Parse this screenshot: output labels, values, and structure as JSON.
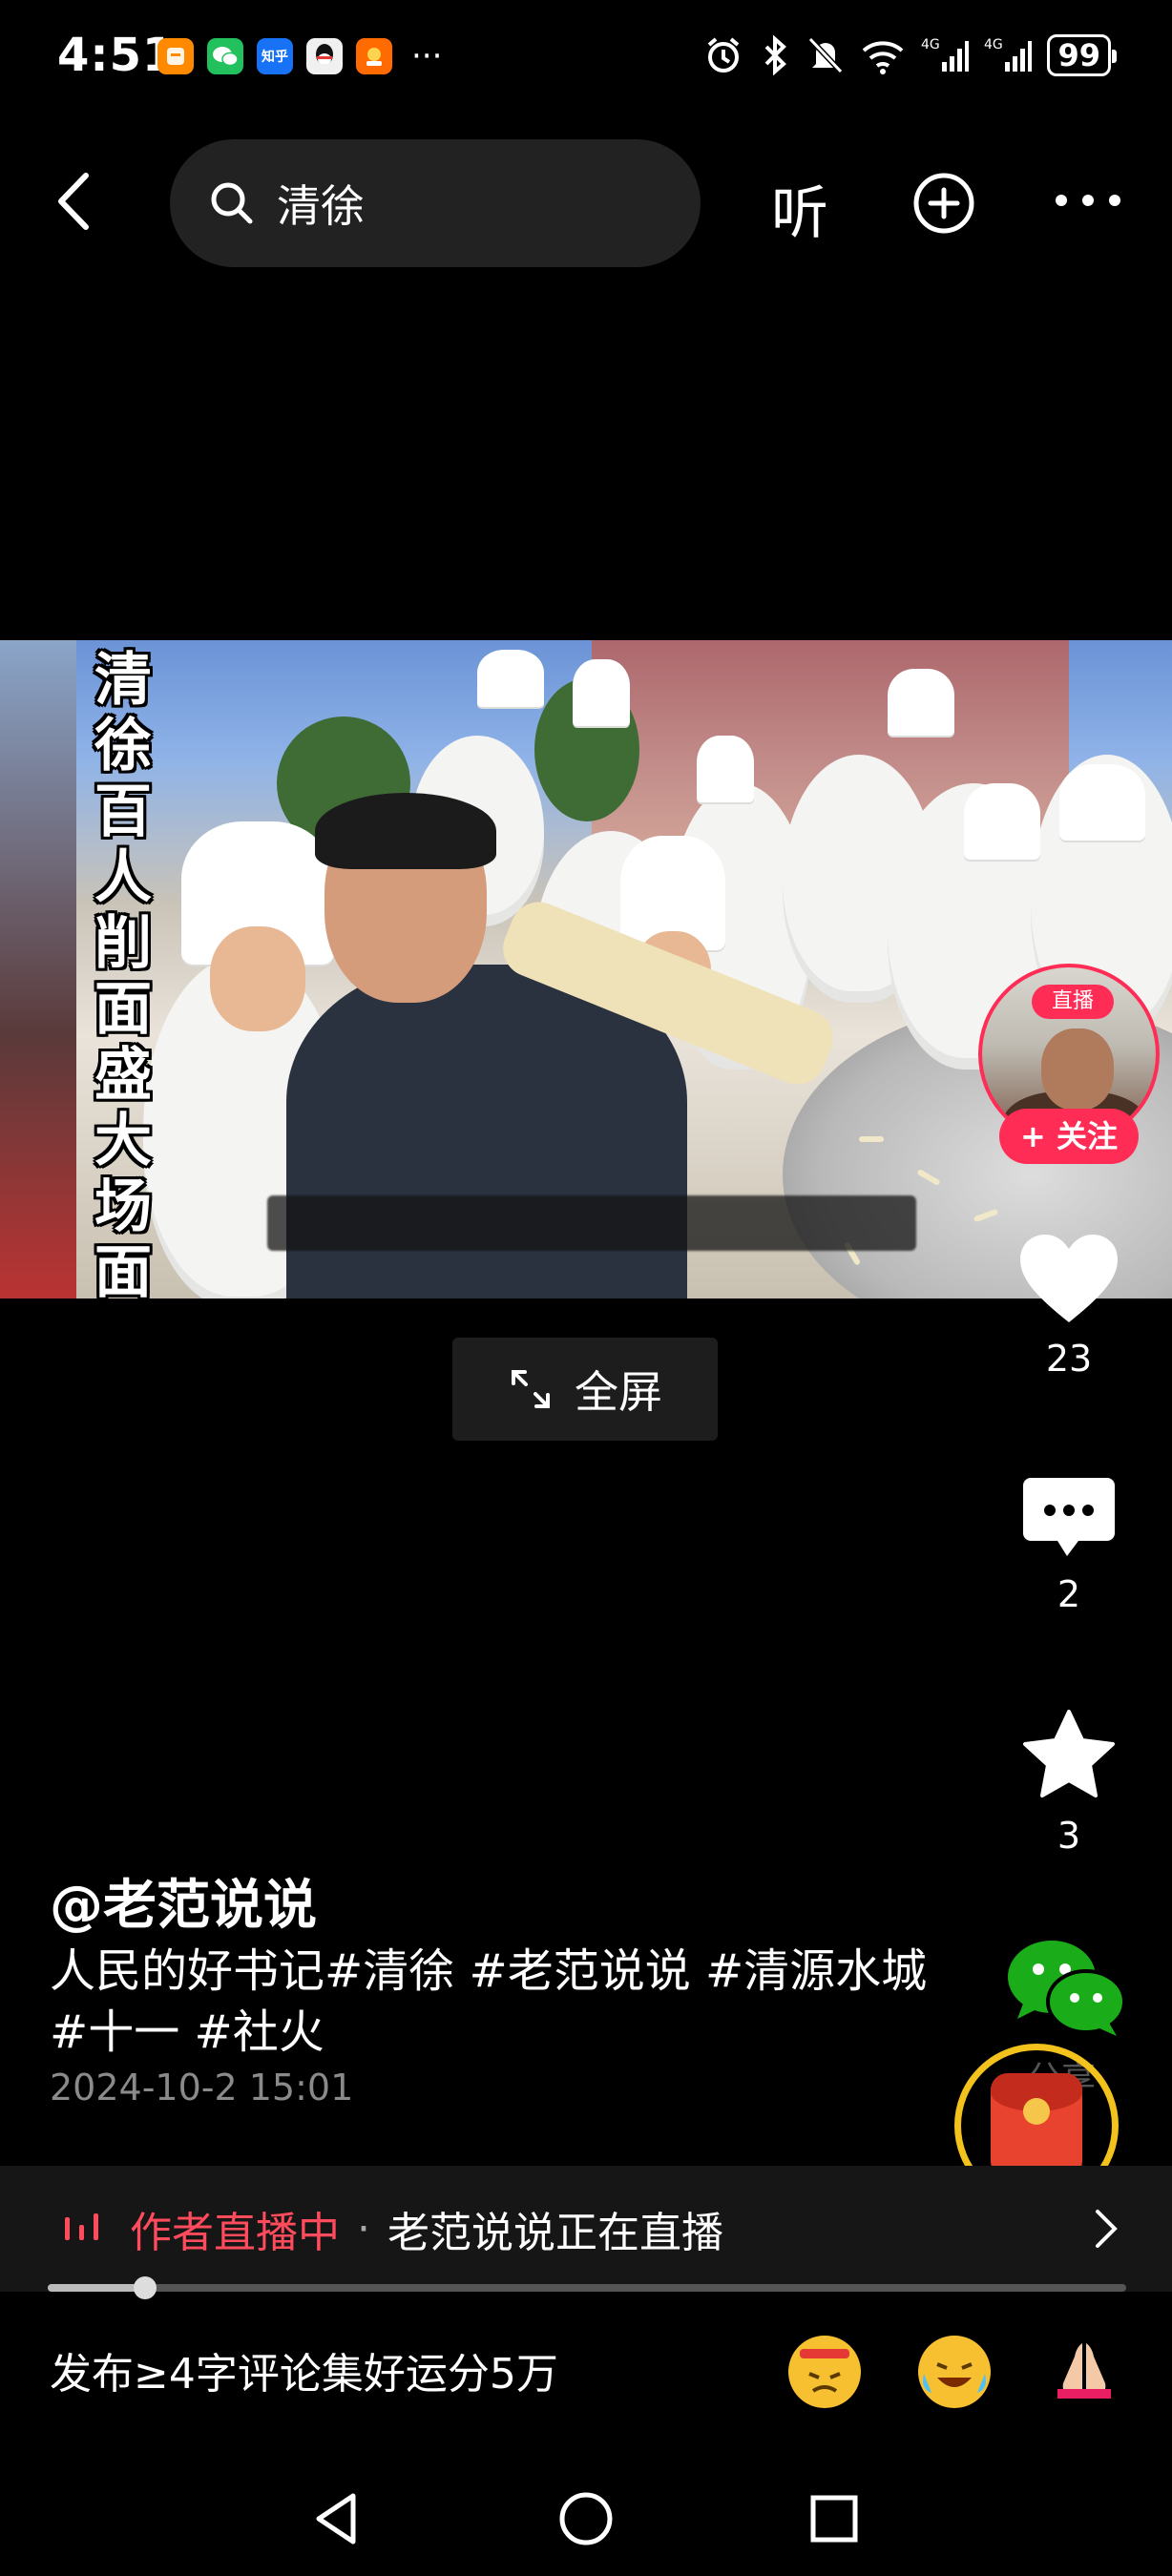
{
  "status_bar": {
    "time": "4:51",
    "apps": [
      {
        "icon": "taobao-icon",
        "color": "#ff8a00",
        "label": ""
      },
      {
        "icon": "wechat-icon",
        "color": "#22c15e",
        "label": ""
      },
      {
        "icon": "zhihu-icon",
        "color": "#1772f6",
        "label": "知乎"
      },
      {
        "icon": "qq-icon",
        "color": "#f0f0f0",
        "label": ""
      },
      {
        "icon": "game-app-icon",
        "color": "#ff6b00",
        "label": ""
      }
    ],
    "more_indicator": "···",
    "battery": "99"
  },
  "nav": {
    "search_text": "清徐",
    "listen_label": "听"
  },
  "video": {
    "overlay_title_chars": [
      "清",
      "徐",
      "百",
      "人",
      "削",
      "面",
      "盛",
      "大",
      "场",
      "面"
    ],
    "fullscreen_label": "全屏"
  },
  "author_avatar": {
    "live_tag": "直播",
    "follow_label": "+ 关注"
  },
  "rail": {
    "like_count": "23",
    "comment_count": "2",
    "favorite_count": "3",
    "share_label": "分享"
  },
  "caption": {
    "author": "@老范说说",
    "description": "人民的好书记#清徐 #老范说说 #清源水城 #十一 #社火",
    "date": "2024-10-2 15:01"
  },
  "live_bar": {
    "title": "作者直播中",
    "separator": "·",
    "description": "老范说说正在直播"
  },
  "progress": {
    "value_fraction": 0.09
  },
  "comment_bar": {
    "placeholder": "发布≥4字评论集好运分5万",
    "emojis": [
      "angry-face-icon",
      "laughing-crying-icon",
      "praying-hands-icon"
    ]
  },
  "colors": {
    "accent": "#ff2d55",
    "live_red": "#ff4b5c",
    "gold_ring": "#f4c21c"
  }
}
